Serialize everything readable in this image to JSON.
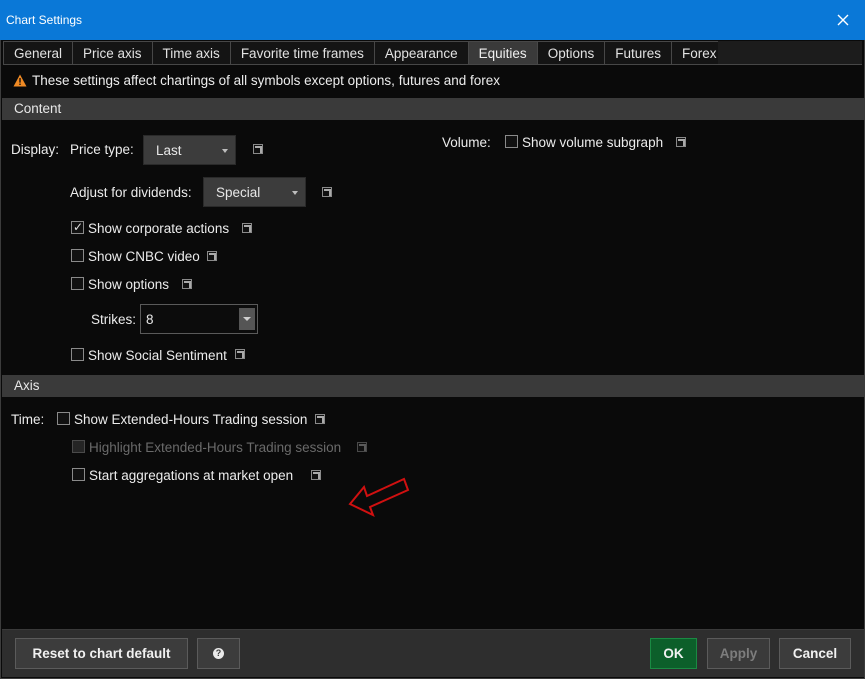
{
  "window": {
    "title": "Chart Settings",
    "close_icon": "close-icon"
  },
  "tabs": [
    {
      "label": "General",
      "active": false
    },
    {
      "label": "Price axis",
      "active": false
    },
    {
      "label": "Time axis",
      "active": false
    },
    {
      "label": "Favorite time frames",
      "active": false
    },
    {
      "label": "Appearance",
      "active": false
    },
    {
      "label": "Equities",
      "active": true
    },
    {
      "label": "Options",
      "active": false
    },
    {
      "label": "Futures",
      "active": false
    },
    {
      "label": "Forex",
      "active": false
    }
  ],
  "notice": "These settings affect chartings of all symbols except options, futures and forex",
  "content": {
    "header": "Content",
    "display_label": "Display:",
    "price_type_label": "Price type:",
    "price_type_value": "Last",
    "adjust_dividends_label": "Adjust for dividends:",
    "adjust_dividends_value": "Special",
    "show_corporate_actions": {
      "label": "Show corporate actions",
      "checked": true
    },
    "show_cnbc_video": {
      "label": "Show CNBC video",
      "checked": false
    },
    "show_options": {
      "label": "Show options",
      "checked": false
    },
    "strikes_label": "Strikes:",
    "strikes_value": "8",
    "show_social_sentiment": {
      "label": "Show Social Sentiment",
      "checked": false
    },
    "volume_label": "Volume:",
    "show_volume_subgraph": {
      "label": "Show volume subgraph",
      "checked": false
    }
  },
  "axis": {
    "header": "Axis",
    "time_label": "Time:",
    "show_extended_hours": {
      "label": "Show Extended-Hours Trading session",
      "checked": false
    },
    "highlight_extended_hours": {
      "label": "Highlight Extended-Hours Trading session",
      "checked": false,
      "disabled": true
    },
    "start_aggregations": {
      "label": "Start aggregations at market open",
      "checked": false
    }
  },
  "footer": {
    "reset_label": "Reset to chart default",
    "help_symbol": "?",
    "ok_label": "OK",
    "apply_label": "Apply",
    "cancel_label": "Cancel"
  },
  "colors": {
    "titlebar": "#0a78d7",
    "background": "#0a0a0a",
    "section_header": "#3a3a3a",
    "ok_button": "#0c5f2a",
    "warning": "#f08a24",
    "annotation_arrow": "#d01010"
  }
}
